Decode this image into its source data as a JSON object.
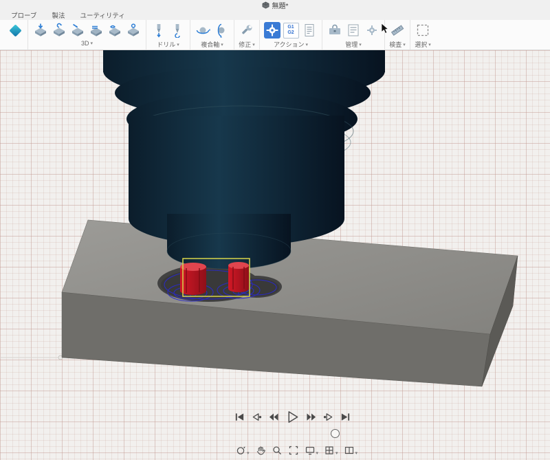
{
  "title_bar": {
    "document_title": "無題*"
  },
  "tab_bar": {
    "tabs": [
      {
        "label": "プローブ"
      },
      {
        "label": "製法"
      },
      {
        "label": "ユーティリティ"
      }
    ]
  },
  "toolbar": {
    "caret": "▾",
    "groups": [
      {
        "label": "3D"
      },
      {
        "label": "ドリル"
      },
      {
        "label": "複合軸"
      },
      {
        "label": "修正"
      },
      {
        "label": "アクション"
      },
      {
        "label": "管理"
      },
      {
        "label": "検査"
      },
      {
        "label": "選択"
      }
    ],
    "g1g2_icon": {
      "line1": "G1",
      "line2": "G2"
    }
  },
  "viewport": {
    "simulation_player": {
      "buttons": [
        "skip-to-start",
        "step-back",
        "play-backward",
        "play",
        "fast-forward",
        "step-forward",
        "skip-to-end"
      ]
    },
    "colors": {
      "tool_holder_dark_blue": "#0d2130",
      "stock_top_gray": "#94938f",
      "stock_front_gray": "#6f6e6a",
      "stock_side_gray": "#5b5a56",
      "toolpath_blue": "#2a2acc",
      "tool_engagement_red": "#c01320",
      "tool_boundary_yellow": "#d8d54a",
      "active_tool_highlight": "#3a7bd5"
    }
  },
  "nav_bar": {
    "items": [
      "orbit",
      "pan",
      "zoom",
      "fit",
      "display-settings",
      "grid-settings",
      "viewports"
    ]
  }
}
